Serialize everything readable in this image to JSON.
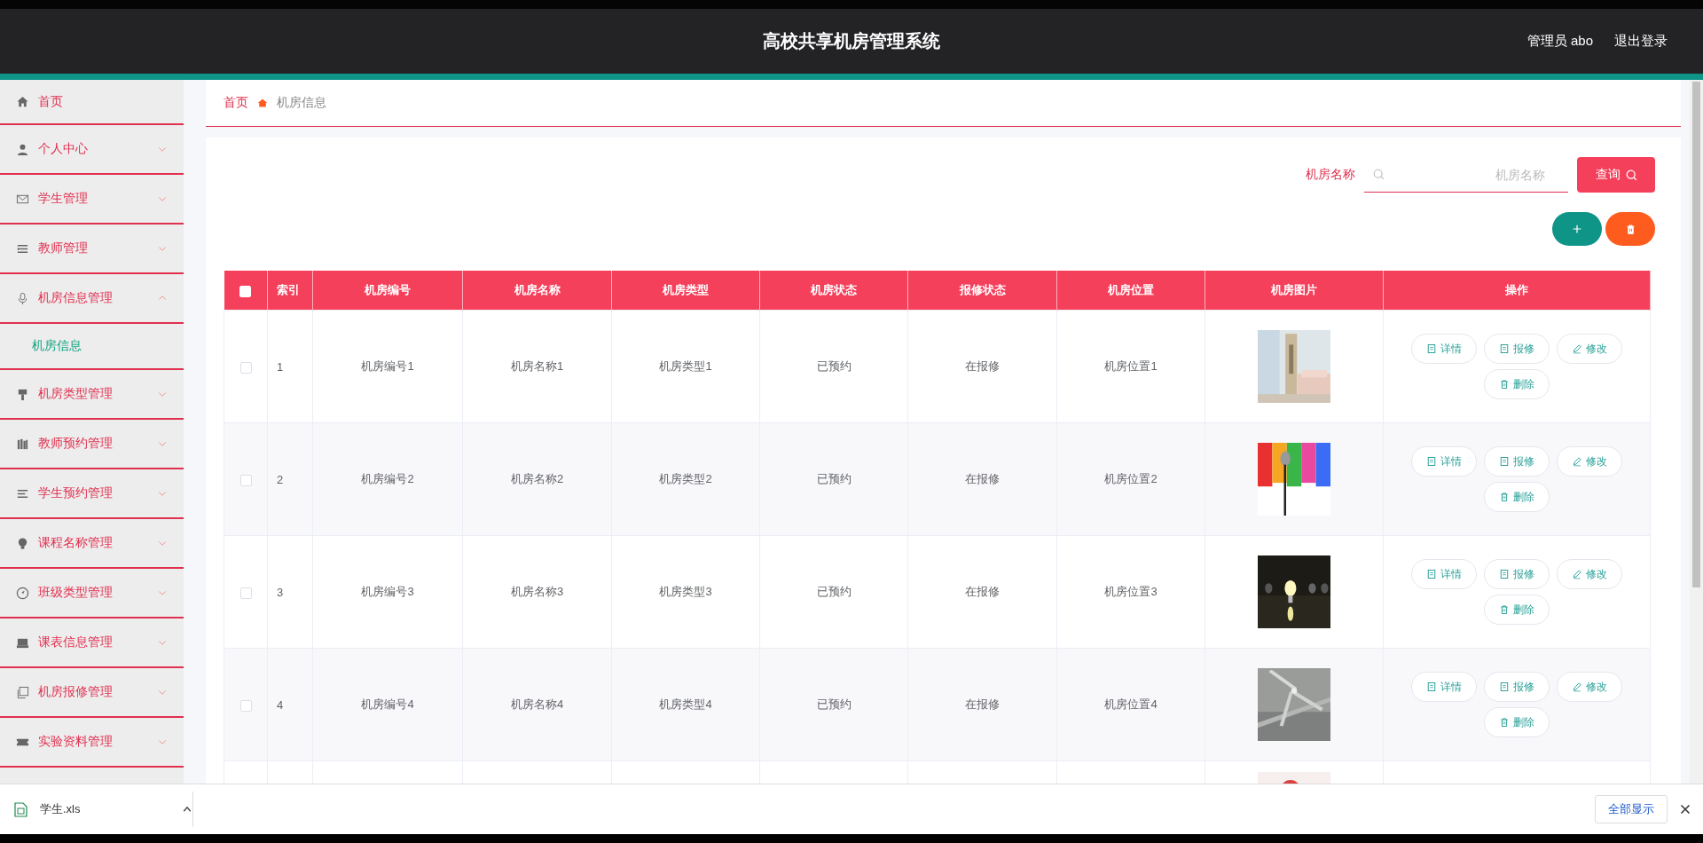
{
  "header": {
    "title": "高校共享机房管理系统",
    "user": "管理员 abo",
    "logout": "退出登录"
  },
  "sidebar": {
    "items": [
      {
        "label": "首页"
      },
      {
        "label": "个人中心",
        "expanded": false
      },
      {
        "label": "学生管理",
        "expanded": false
      },
      {
        "label": "教师管理",
        "expanded": false
      },
      {
        "label": "机房信息管理",
        "expanded": true,
        "children": [
          {
            "label": "机房信息",
            "selected": true
          }
        ]
      },
      {
        "label": "机房类型管理",
        "expanded": false
      },
      {
        "label": "教师预约管理",
        "expanded": false
      },
      {
        "label": "学生预约管理",
        "expanded": false
      },
      {
        "label": "课程名称管理",
        "expanded": false
      },
      {
        "label": "班级类型管理",
        "expanded": false
      },
      {
        "label": "课表信息管理",
        "expanded": false
      },
      {
        "label": "机房报修管理",
        "expanded": false
      },
      {
        "label": "实验资料管理",
        "expanded": false
      }
    ]
  },
  "breadcrumb": [
    "首页",
    "机房信息"
  ],
  "search": {
    "label": "机房名称",
    "placeholder": "机房名称",
    "button": "查询"
  },
  "toolbar": [
    {
      "kind": "add"
    },
    {
      "kind": "delete"
    }
  ],
  "table": {
    "select_all": false,
    "columns": [
      "索引",
      "机房编号",
      "机房名称",
      "机房类型",
      "机房状态",
      "报修状态",
      "机房位置",
      "机房图片",
      "操作"
    ],
    "rows": [
      {
        "checked": false,
        "cells": [
          "1",
          "机房编号1",
          "机房名称1",
          "机房类型1",
          "已预约",
          "在报修",
          "机房位置1"
        ],
        "actions": [
          "详情",
          "报修",
          "修改",
          "删除"
        ]
      },
      {
        "checked": false,
        "cells": [
          "2",
          "机房编号2",
          "机房名称2",
          "机房类型2",
          "已预约",
          "在报修",
          "机房位置2"
        ],
        "actions": [
          "详情",
          "报修",
          "修改",
          "删除"
        ]
      },
      {
        "checked": false,
        "cells": [
          "3",
          "机房编号3",
          "机房名称3",
          "机房类型3",
          "已预约",
          "在报修",
          "机房位置3"
        ],
        "actions": [
          "详情",
          "报修",
          "修改",
          "删除"
        ]
      },
      {
        "checked": false,
        "cells": [
          "4",
          "机房编号4",
          "机房名称4",
          "机房类型4",
          "已预约",
          "在报修",
          "机房位置4"
        ],
        "actions": [
          "详情",
          "报修",
          "修改",
          "删除"
        ]
      }
    ]
  },
  "download_bar": {
    "file": "学生.xls",
    "show_all": "全部显示"
  }
}
